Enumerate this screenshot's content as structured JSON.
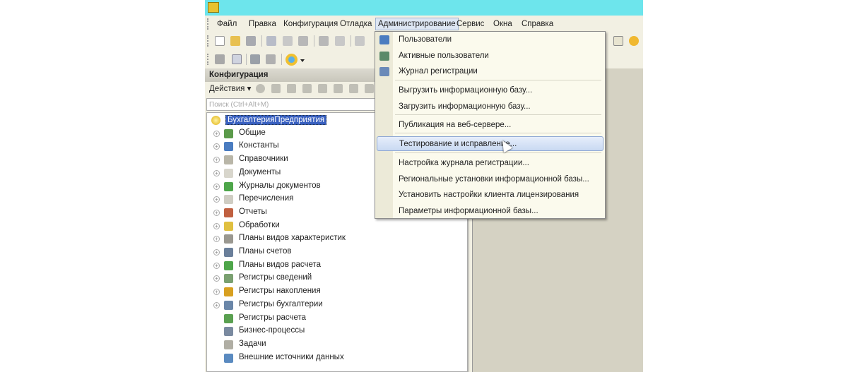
{
  "menubar": [
    "Файл",
    "Правка",
    "Конфигурация",
    "Отладка",
    "Администрирование",
    "Сервис",
    "Окна",
    "Справка"
  ],
  "panel": {
    "title": "Конфигурация",
    "actions_label": "Действия ▾",
    "search_placeholder": "Поиск (Ctrl+Alt+M)"
  },
  "tree": [
    {
      "label": "БухгалтерияПредприятия",
      "color": "#e0b010",
      "root": true
    },
    {
      "label": "Общие",
      "color": "#5b9a4a",
      "plus": true
    },
    {
      "label": "Константы",
      "color": "#4a7cc0",
      "plus": true
    },
    {
      "label": "Справочники",
      "color": "#b9b6a8",
      "plus": true
    },
    {
      "label": "Документы",
      "color": "#d8d6cc",
      "plus": true
    },
    {
      "label": "Журналы документов",
      "color": "#4ea64a",
      "plus": true
    },
    {
      "label": "Перечисления",
      "color": "#cfcdc3",
      "plus": true
    },
    {
      "label": "Отчеты",
      "color": "#c06040",
      "plus": true
    },
    {
      "label": "Обработки",
      "color": "#e0c040",
      "plus": true
    },
    {
      "label": "Планы видов характеристик",
      "color": "#9a9890",
      "plus": true
    },
    {
      "label": "Планы счетов",
      "color": "#6a7f9a",
      "plus": true
    },
    {
      "label": "Планы видов расчета",
      "color": "#4ea64a",
      "plus": true
    },
    {
      "label": "Регистры сведений",
      "color": "#7aa070",
      "plus": true
    },
    {
      "label": "Регистры накопления",
      "color": "#d8a020",
      "plus": true
    },
    {
      "label": "Регистры бухгалтерии",
      "color": "#6a86a8",
      "plus": true
    },
    {
      "label": "Регистры расчета",
      "color": "#5aa050"
    },
    {
      "label": "Бизнес-процессы",
      "color": "#7a8aa0"
    },
    {
      "label": "Задачи",
      "color": "#b0aea4"
    },
    {
      "label": "Внешние источники данных",
      "color": "#5a8ac0"
    }
  ],
  "menu": {
    "items": [
      {
        "label": "Пользователи",
        "icon": "user-icon",
        "color": "#4a7cc0"
      },
      {
        "label": "Активные пользователи",
        "icon": "active-users-icon",
        "color": "#5b8a6a"
      },
      {
        "label": "Журнал регистрации",
        "icon": "log-icon",
        "color": "#6a8ab8"
      },
      {
        "label": "Выгрузить информационную базу..."
      },
      {
        "label": "Загрузить информационную базу..."
      },
      {
        "label": "Публикация на веб-сервере..."
      },
      {
        "label": "Тестирование и исправление...",
        "highlighted": true
      },
      {
        "label": "Настройка журнала регистрации..."
      },
      {
        "label": "Региональные установки информационной базы..."
      },
      {
        "label": "Установить настройки клиента лицензирования"
      },
      {
        "label": "Параметры информационной базы..."
      }
    ]
  }
}
